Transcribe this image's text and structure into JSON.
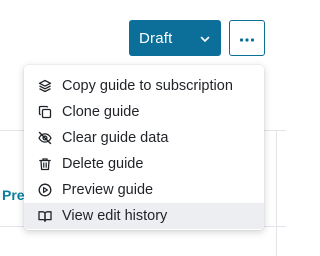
{
  "toolbar": {
    "status_label": "Draft",
    "primary_color": "#0b6f9a"
  },
  "background": {
    "partial_text": "Pre"
  },
  "menu": {
    "items": [
      {
        "label": "Copy guide to subscription",
        "icon": "layers-icon"
      },
      {
        "label": "Clone guide",
        "icon": "copy-icon"
      },
      {
        "label": "Clear guide data",
        "icon": "eye-off-icon"
      },
      {
        "label": "Delete guide",
        "icon": "trash-icon"
      },
      {
        "label": "Preview guide",
        "icon": "play-circle-icon"
      },
      {
        "label": "View edit history",
        "icon": "book-open-icon",
        "highlighted": true
      }
    ]
  }
}
